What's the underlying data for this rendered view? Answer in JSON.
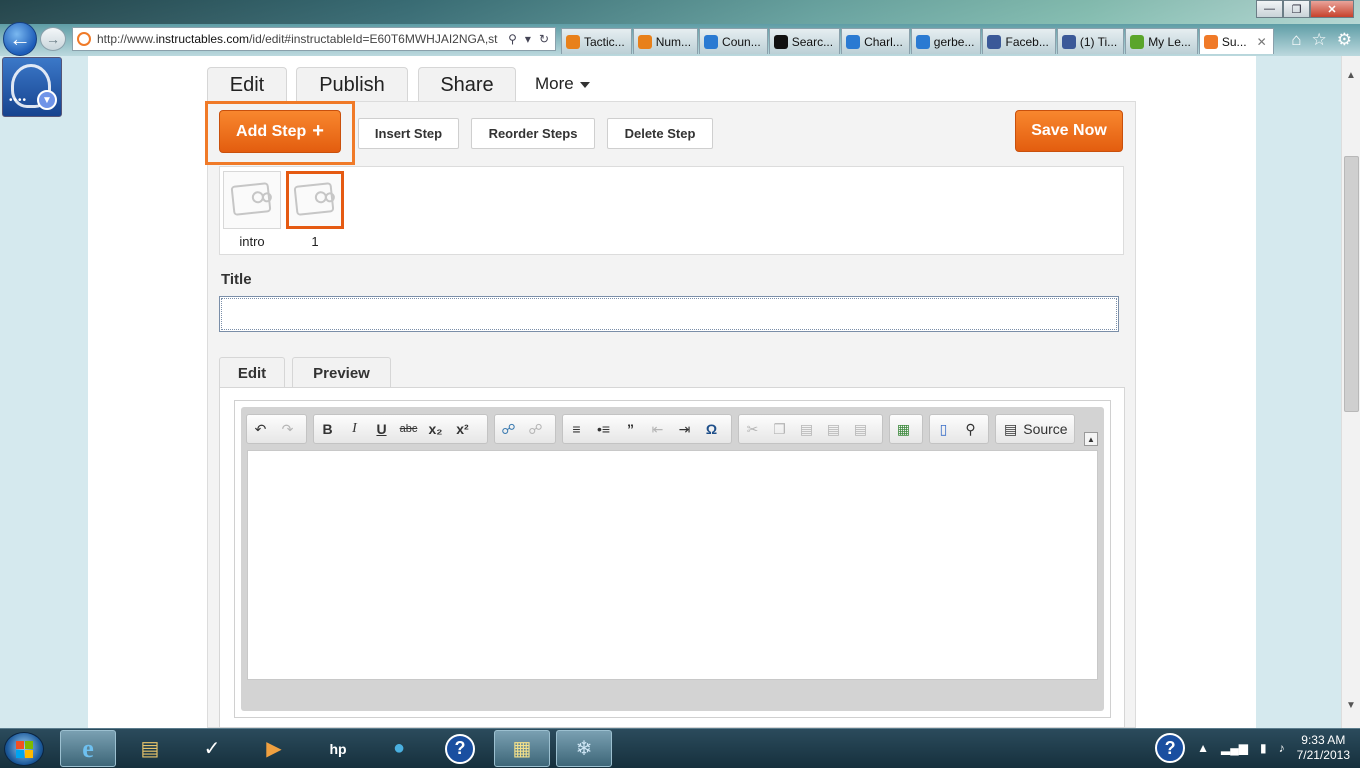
{
  "browser": {
    "url_prefix": "http://www.",
    "url_domain": "instructables.com",
    "url_rest": "/id/edit#instructableId=E60T6MWHJAI2NGA,st",
    "tabs": [
      {
        "label": "Tactic...",
        "icon": "fire-icon",
        "color": "#e8801a"
      },
      {
        "label": "Num...",
        "icon": "fire-icon",
        "color": "#e8801a"
      },
      {
        "label": "Coun...",
        "icon": "ie-icon",
        "color": "#2a7ad2"
      },
      {
        "label": "Searc...",
        "icon": "shield-icon",
        "color": "#111111"
      },
      {
        "label": "Charl...",
        "icon": "ie-icon",
        "color": "#2a7ad2"
      },
      {
        "label": "gerbe...",
        "icon": "ie-globe-icon",
        "color": "#2a7ad2"
      },
      {
        "label": "Faceb...",
        "icon": "facebook-icon",
        "color": "#3b5998"
      },
      {
        "label": "(1) Ti...",
        "icon": "facebook-icon",
        "color": "#3b5998"
      },
      {
        "label": "My Le...",
        "icon": "green-square-icon",
        "color": "#5aa52a"
      },
      {
        "label": "Su...",
        "icon": "instructables-icon",
        "color": "#f07a28"
      }
    ]
  },
  "page": {
    "top_tabs": [
      "Edit",
      "Publish",
      "Share"
    ],
    "more_label": "More",
    "add_step_label": "Add Step",
    "insert_step_label": "Insert Step",
    "reorder_steps_label": "Reorder Steps",
    "delete_step_label": "Delete Step",
    "save_now_label": "Save Now",
    "steps": [
      {
        "label": "intro",
        "selected": false
      },
      {
        "label": "1",
        "selected": true
      }
    ],
    "title_label": "Title",
    "title_value": "",
    "editor_tabs": [
      "Edit",
      "Preview"
    ],
    "source_label": "Source"
  },
  "colors": {
    "accent_orange": "#f07a28",
    "selected_border": "#e55a12"
  },
  "taskbar": {
    "apps": [
      "ie-icon",
      "file-explorer-icon",
      "stock-chart-icon",
      "media-player-icon",
      "hp-icon",
      "globe-icon",
      "help-icon",
      "folder-map-icon",
      "network-app-icon"
    ],
    "time": "9:33 AM",
    "date": "7/21/2013"
  }
}
